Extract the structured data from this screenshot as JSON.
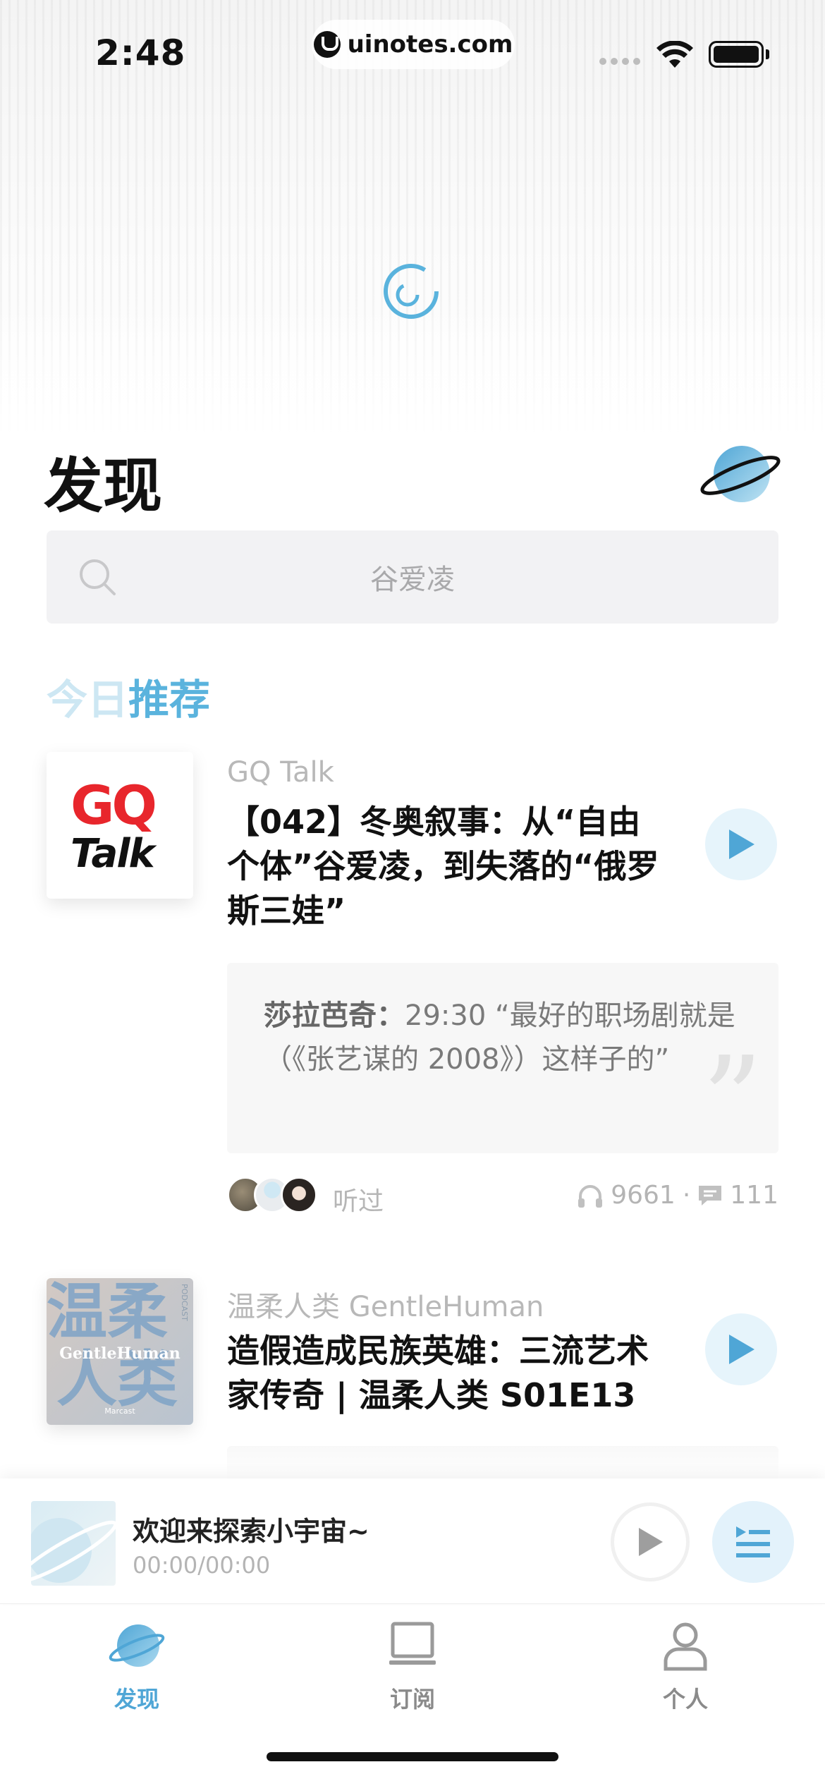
{
  "status_bar": {
    "time": "2:48",
    "url": "uinotes.com"
  },
  "header": {
    "title": "发现"
  },
  "search": {
    "placeholder": "谷爱凌"
  },
  "recommend": {
    "title_light": "今日",
    "title_dark": "推荐"
  },
  "episodes": [
    {
      "podcast": "GQ Talk",
      "cover_text_1": "GQ",
      "cover_text_2": "Talk",
      "title": "【042】冬奥叙事：从“自由个体”谷爱凌，到失落的“俄罗斯三娃”",
      "comment_author": "莎拉芭奇：",
      "comment_body": "29:30 “最好的职场剧就是（《张艺谋的 2008》）这样子的”",
      "listened_label": "听过",
      "plays": "9661",
      "separator": "·",
      "comments": "111"
    },
    {
      "podcast": "温柔人类 GentleHuman",
      "cover_big_1": "温柔",
      "cover_big_2": "人类",
      "cover_name": "GentleHuman",
      "cover_small": "Marcast",
      "cover_vertical": "PODCAST",
      "title": "造假造成民族英雄：三流艺术家传奇 | 温柔人类 S01E13"
    }
  ],
  "mini_player": {
    "title": "欢迎来探索小宇宙~",
    "time": "00:00/00:00"
  },
  "tabs": [
    {
      "label": "发现",
      "icon": "planet-icon",
      "active": true
    },
    {
      "label": "订阅",
      "icon": "subscribe-icon",
      "active": false
    },
    {
      "label": "个人",
      "icon": "person-icon",
      "active": false
    }
  ],
  "colors": {
    "accent": "#5ab3dd",
    "play_bg": "#e6f4fb",
    "search_bg": "#f2f2f4"
  }
}
